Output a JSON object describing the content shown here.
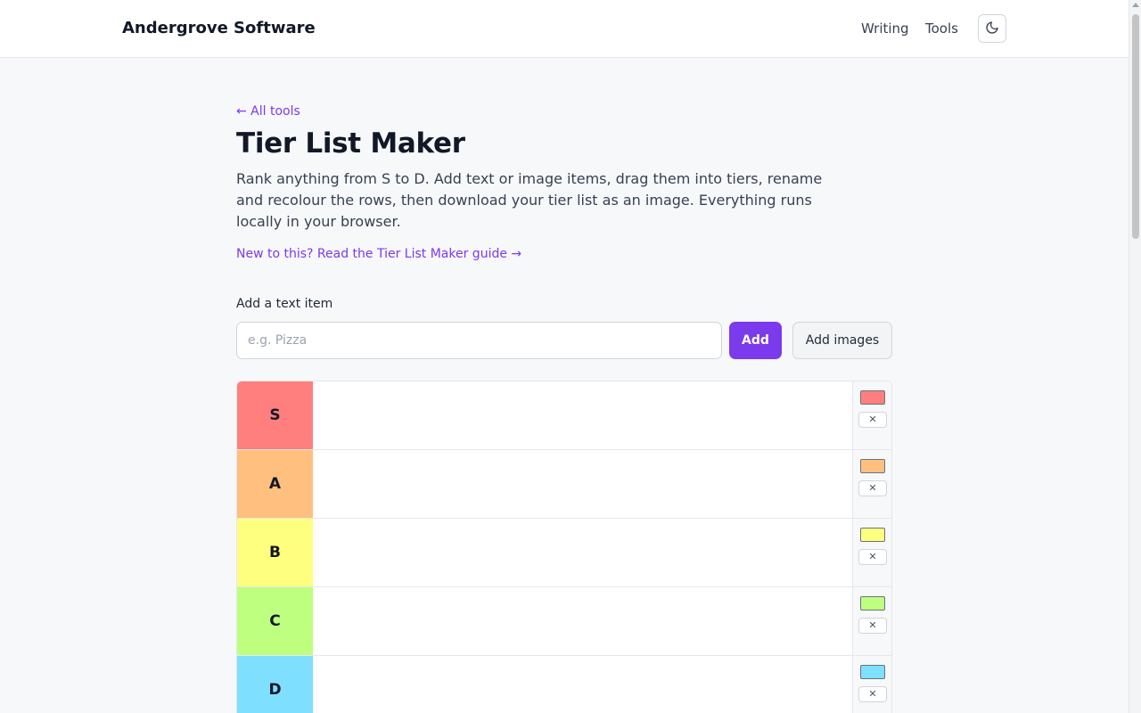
{
  "header": {
    "brand": "Andergrove Software",
    "nav": [
      {
        "label": "Writing"
      },
      {
        "label": "Tools"
      }
    ],
    "theme_icon": "moon-icon"
  },
  "page": {
    "back_link": "← All tools",
    "title": "Tier List Maker",
    "description": "Rank anything from S to D. Add text or image items, drag them into tiers, rename and recolour the rows, then download your tier list as an image. Everything runs locally in your browser.",
    "guide_link": "New to this? Read the Tier List Maker guide →"
  },
  "add_item": {
    "label": "Add a text item",
    "placeholder": "e.g. Pizza",
    "value": "",
    "add_label": "Add",
    "images_label": "Add images"
  },
  "tiers": [
    {
      "label": "S",
      "color": "#ff7f7f",
      "remove": "✕"
    },
    {
      "label": "A",
      "color": "#ffbf7f",
      "remove": "✕"
    },
    {
      "label": "B",
      "color": "#ffff7f",
      "remove": "✕"
    },
    {
      "label": "C",
      "color": "#bfff7f",
      "remove": "✕"
    },
    {
      "label": "D",
      "color": "#7fdfff",
      "remove": "✕"
    }
  ]
}
